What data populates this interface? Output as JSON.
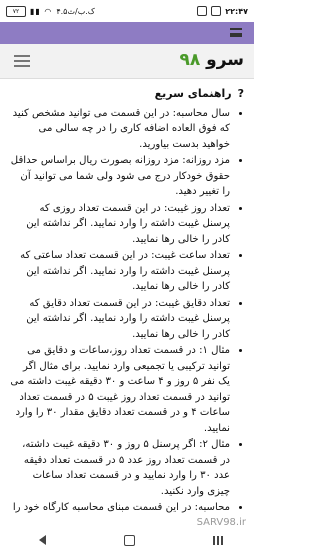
{
  "statusbar": {
    "time": "۲۲:۴۷",
    "battery": "۷۲",
    "network_text": "۴.۵ک.ب/ث"
  },
  "header": {
    "title_word": "سرو",
    "title_num": "۹۸"
  },
  "section": {
    "title": "راهنمای سریع",
    "marker": "?"
  },
  "items": [
    "سال محاسبه: در این قسمت می توانید مشخص کنید که فوق العاده اضافه کاری را در چه سالی می خواهید بدست بیاورید.",
    "مزد روزانه: مزد روزانه بصورت ریال براساس حداقل حقوق خودکار درج می شود ولی شما می توانید آن را تغییر دهید.",
    "تعداد روز غیبت: در این قسمت تعداد روزی که پرسنل غیبت داشته را وارد نمایید. اگر نداشته این کادر را خالی رها نمایید.",
    "تعداد ساعت غیبت: در این قسمت تعداد ساعتی که پرسنل غیبت داشته را وارد نمایید. اگر نداشته این کادر را خالی رها نمایید.",
    "تعداد دقایق غیبت: در این قسمت تعداد دقایق که پرسنل غیبت داشته را وارد نمایید. اگر نداشته این کادر را خالی رها نمایید.",
    "مثال ۱: در قسمت تعداد روز،ساعات و دقایق می توانید ترکیبی یا تجمیعی وارد نمایید. برای مثال اگر یک نفر ۵ روز و ۴ ساعت و ۳۰ دقیقه غیبت داشته می توانید در قسمت تعداد روز غیبت ۵ در قسمت تعداد ساعات ۴ و در قسمت تعداد دقایق مقدار ۳۰ را وارد نمایید.",
    "مثال ۲: اگر پرسنل ۵ روز و ۳۰ دقیقه غیبت داشته، در قسمت تعداد روز عدد ۵ در قسمت تعداد دقیقه عدد ۳۰ را وارد نمایید و در قسمت تعداد ساعات چیزی وارد نکنید.",
    "محاسبه: در این قسمت مبنای محاسبه کارگاه خود را"
  ],
  "watermark": "SARV98.ir"
}
